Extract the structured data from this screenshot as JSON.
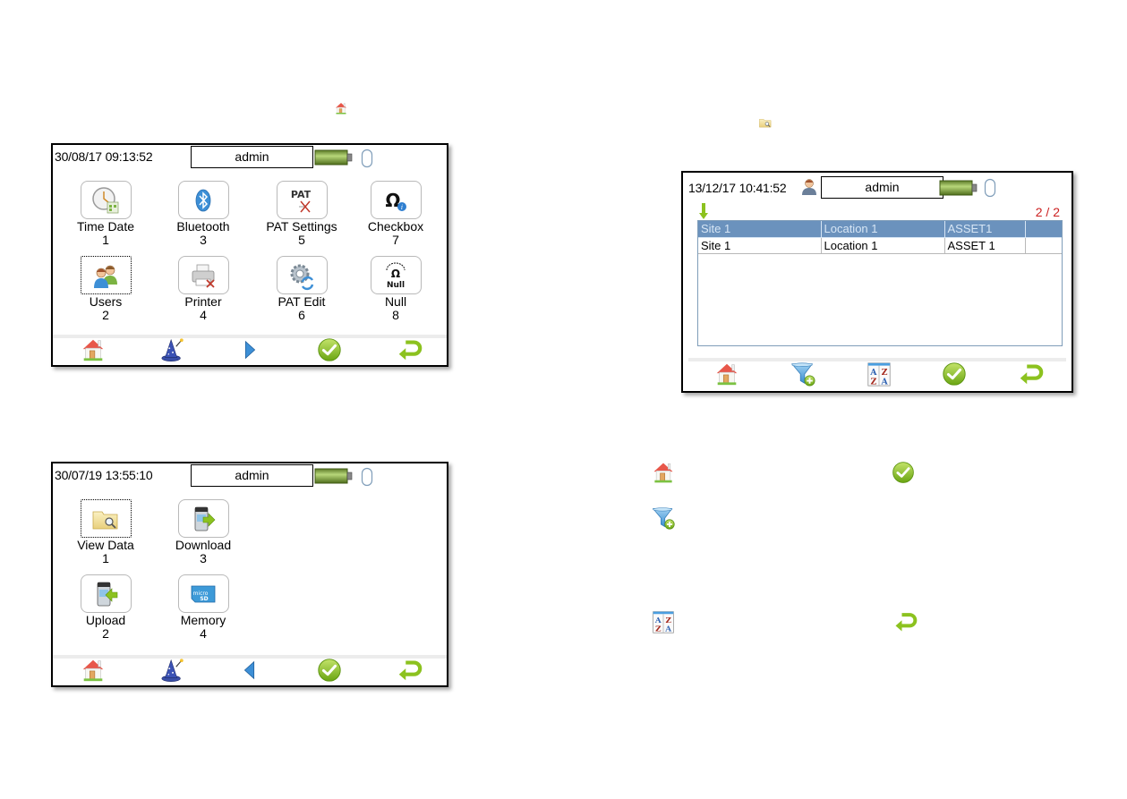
{
  "inline_icons": {
    "home_small": "home-icon",
    "folder_small": "folder-search-icon"
  },
  "settings_screen": {
    "datetime": "30/08/17 09:13:52",
    "user": "admin",
    "battery_level": "full",
    "items": [
      {
        "label": "Time Date",
        "number": "1",
        "icon": "clock-calendar-icon",
        "focused": false
      },
      {
        "label": "Users",
        "number": "2",
        "icon": "users-icon",
        "focused": true
      },
      {
        "label": "Bluetooth",
        "number": "3",
        "icon": "bluetooth-icon",
        "focused": false
      },
      {
        "label": "Printer",
        "number": "4",
        "icon": "printer-icon",
        "focused": false
      },
      {
        "label": "PAT Settings",
        "number": "5",
        "icon": "pat-settings-icon",
        "focused": false
      },
      {
        "label": "PAT Edit",
        "number": "6",
        "icon": "gear-edit-icon",
        "focused": false
      },
      {
        "label": "Checkbox",
        "number": "7",
        "icon": "omega-info-icon",
        "focused": false
      },
      {
        "label": "Null",
        "number": "8",
        "icon": "omega-null-icon",
        "focused": false
      }
    ],
    "toolbar": [
      "home-icon",
      "wizard-hat-icon",
      "next-arrow-icon",
      "confirm-check-icon",
      "back-return-icon"
    ]
  },
  "data_screen": {
    "datetime": "30/07/19 13:55:10",
    "user": "admin",
    "battery_level": "full",
    "items": [
      {
        "label": "View Data",
        "number": "1",
        "icon": "folder-search-icon",
        "focused": true
      },
      {
        "label": "Upload",
        "number": "2",
        "icon": "upload-icon",
        "focused": false
      },
      {
        "label": "Download",
        "number": "3",
        "icon": "download-icon",
        "focused": false
      },
      {
        "label": "Memory",
        "number": "4",
        "icon": "micro-sd-icon",
        "focused": false
      }
    ],
    "toolbar": [
      "home-icon",
      "wizard-hat-icon",
      "prev-arrow-icon",
      "confirm-check-icon",
      "back-return-icon"
    ]
  },
  "view_screen": {
    "datetime": "13/12/17 10:41:52",
    "user": "admin",
    "battery_level": "full",
    "page_count": "2 / 2",
    "rows": [
      {
        "site": "Site 1",
        "location": "Location 1",
        "asset": "ASSET1",
        "selected": true
      },
      {
        "site": "Site 1",
        "location": "Location 1",
        "asset": "ASSET 1",
        "selected": false
      }
    ],
    "toolbar": [
      "home-icon",
      "filter-add-icon",
      "sort-az-icon",
      "confirm-check-icon",
      "back-return-icon"
    ]
  },
  "legend": [
    "home-icon",
    "confirm-check-icon",
    "filter-add-icon",
    "sort-az-icon",
    "back-return-icon"
  ],
  "colors": {
    "selected_row": "#6b92bd",
    "page_count": "#cc1f1f",
    "check_green": "#8cc21f",
    "arrow_blue": "#3d8fd6"
  }
}
